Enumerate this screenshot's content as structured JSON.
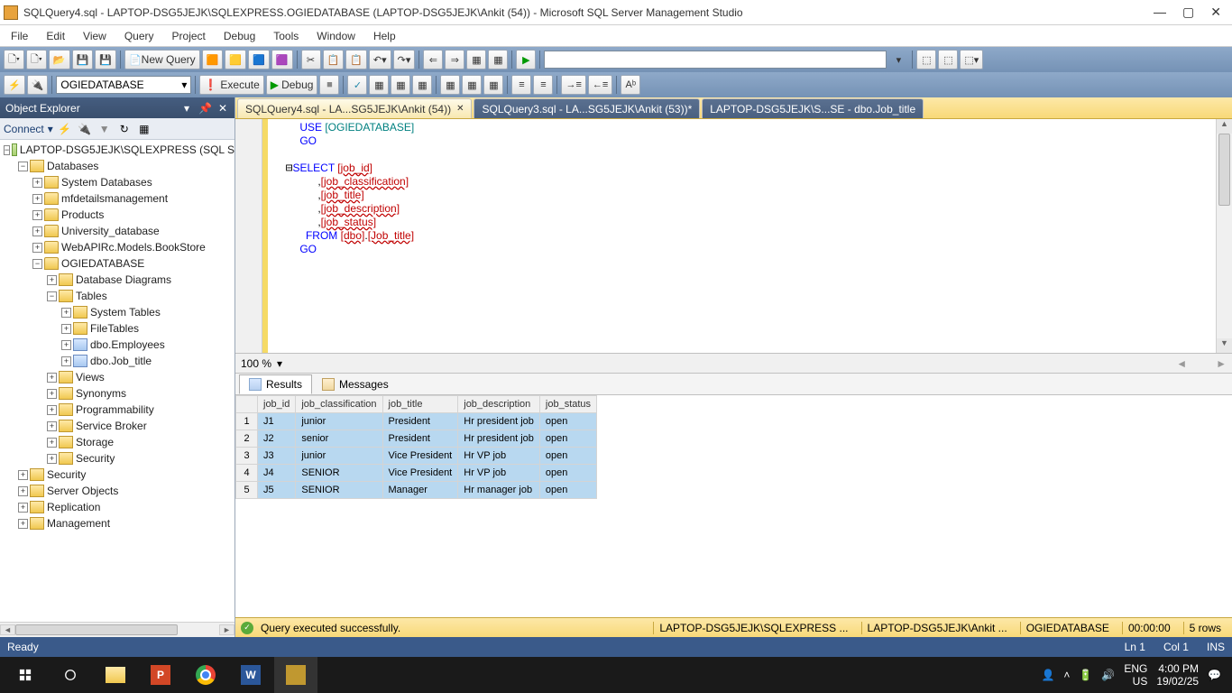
{
  "window": {
    "title": "SQLQuery4.sql - LAPTOP-DSG5JEJK\\SQLEXPRESS.OGIEDATABASE (LAPTOP-DSG5JEJK\\Ankit (54)) - Microsoft SQL Server Management Studio"
  },
  "menu": [
    "File",
    "Edit",
    "View",
    "Query",
    "Project",
    "Debug",
    "Tools",
    "Window",
    "Help"
  ],
  "toolbar": {
    "new_query": "New Query",
    "database": "OGIEDATABASE",
    "execute": "Execute",
    "debug": "Debug"
  },
  "object_explorer": {
    "title": "Object Explorer",
    "connect": "Connect",
    "root": "LAPTOP-DSG5JEJK\\SQLEXPRESS (SQL S",
    "databases": "Databases",
    "sysdbs": "System Databases",
    "userdbs": [
      "mfdetailsmanagement",
      "Products",
      "University_database",
      "WebAPIRc.Models.BookStore",
      "OGIEDATABASE"
    ],
    "ogie_children": {
      "diagrams": "Database Diagrams",
      "tables": "Tables",
      "systables": "System Tables",
      "filetables": "FileTables",
      "t1": "dbo.Employees",
      "t2": "dbo.Job_title",
      "views": "Views",
      "synonyms": "Synonyms",
      "prog": "Programmability",
      "sb": "Service Broker",
      "storage": "Storage",
      "sec": "Security"
    },
    "root_children": [
      "Security",
      "Server Objects",
      "Replication",
      "Management"
    ]
  },
  "tabs": [
    {
      "label": "SQLQuery4.sql - LA...SG5JEJK\\Ankit (54))",
      "active": true
    },
    {
      "label": "SQLQuery3.sql - LA...SG5JEJK\\Ankit (53))*",
      "active": false
    },
    {
      "label": "LAPTOP-DSG5JEJK\\S...SE - dbo.Job_title",
      "active": false
    }
  ],
  "editor": {
    "zoom": "100 %",
    "sql": {
      "l1a": "USE ",
      "l1b": "[OGIEDATABASE]",
      "l2": "GO",
      "l4a": "SELECT ",
      "l4b": "[job_id]",
      "l5": "      ,",
      "l5b": "[job_classification]",
      "l6": "      ,",
      "l6b": "[job_title]",
      "l7": "      ,",
      "l7b": "[job_description]",
      "l8": "      ,",
      "l8b": "[job_status]",
      "l9a": "  FROM ",
      "l9b": "[dbo]",
      "l9c": ".",
      "l9d": "[Job_title]",
      "l10": "GO"
    }
  },
  "results": {
    "tab_results": "Results",
    "tab_messages": "Messages",
    "columns": [
      "",
      "job_id",
      "job_classification",
      "job_title",
      "job_description",
      "job_status"
    ],
    "rows": [
      [
        "1",
        "J1",
        "junior",
        "President",
        "Hr president job",
        "open"
      ],
      [
        "2",
        "J2",
        "senior",
        "President",
        "Hr president job",
        "open"
      ],
      [
        "3",
        "J3",
        "junior",
        "Vice President",
        "Hr VP job",
        "open"
      ],
      [
        "4",
        "J4",
        "SENIOR",
        "Vice President",
        "Hr VP job",
        "open"
      ],
      [
        "5",
        "J5",
        "SENIOR",
        "Manager",
        "Hr manager job",
        "open"
      ]
    ]
  },
  "execbar": {
    "msg": "Query executed successfully.",
    "server": "LAPTOP-DSG5JEJK\\SQLEXPRESS ...",
    "user": "LAPTOP-DSG5JEJK\\Ankit ...",
    "db": "OGIEDATABASE",
    "time": "00:00:00",
    "rows": "5 rows"
  },
  "statusbar": {
    "ready": "Ready",
    "ln": "Ln 1",
    "col": "Col 1",
    "ins": "INS"
  },
  "taskbar": {
    "lang1": "ENG",
    "lang2": "US",
    "time": "4:00 PM",
    "date": "19/02/25"
  }
}
